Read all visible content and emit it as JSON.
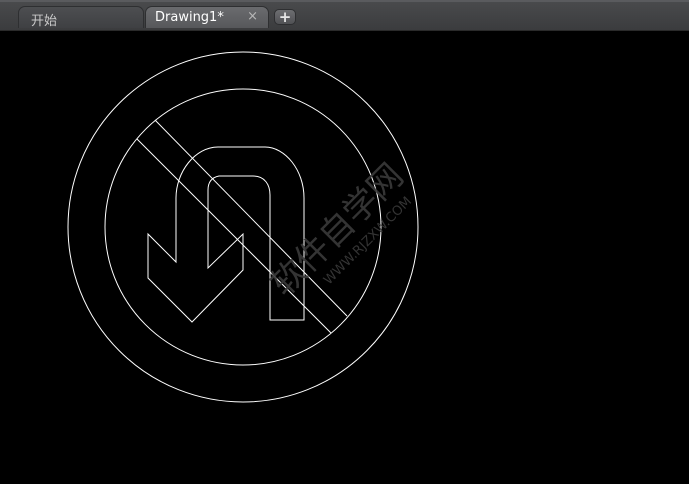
{
  "tabs": [
    {
      "label": "开始"
    },
    {
      "label": "Drawing1*"
    }
  ],
  "tab_close_glyph": "×",
  "tab_add_glyph": "+",
  "watermark": {
    "main": "软件自学网",
    "url": "WWW.RJZXW.COM"
  },
  "colors": {
    "canvas_background": "#000000",
    "drawing_lines": "#ffffff",
    "watermark": "#3a3a3a"
  }
}
